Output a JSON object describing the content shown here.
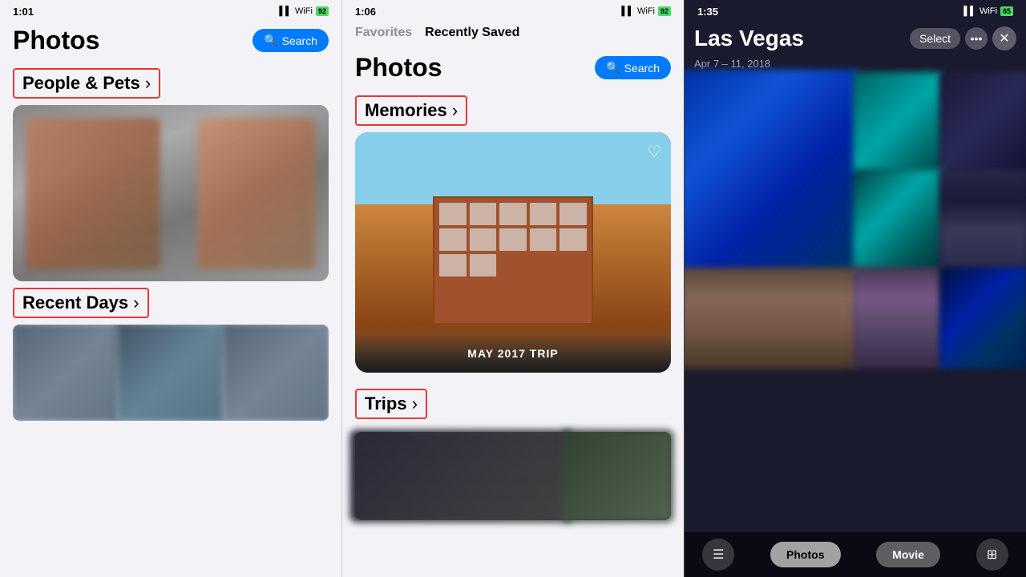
{
  "screen1": {
    "statusBar": {
      "time": "1:01",
      "signal": "▌▌",
      "wifi": "WiFi",
      "battery": "92"
    },
    "header": {
      "title": "Photos",
      "searchLabel": "Search"
    },
    "sections": {
      "peopleAndPets": "People & Pets",
      "recentDays": "Recent Days"
    }
  },
  "screen2": {
    "statusBar": {
      "time": "1:06",
      "signal": "▌▌",
      "wifi": "WiFi",
      "battery": "92"
    },
    "header": {
      "title": "Photos",
      "searchLabel": "Search"
    },
    "tabs": {
      "favorites": "Favorites",
      "recentlySaved": "Recently Saved"
    },
    "sections": {
      "memories": "Memories",
      "trips": "Trips",
      "memoriesCardLabel": "MAY 2017 TRIP"
    }
  },
  "screen3": {
    "statusBar": {
      "time": "1:35",
      "signal": "▌▌",
      "wifi": "WiFi",
      "battery": "85"
    },
    "header": {
      "title": "Las Vegas",
      "dateRange": "Apr 7 – 11, 2018",
      "selectLabel": "Select",
      "moreLabel": "•••",
      "closeLabel": "✕"
    },
    "toolbar": {
      "menuIcon": "☰",
      "photosLabel": "Photos",
      "movieLabel": "Movie",
      "gridIcon": "⊞"
    }
  }
}
